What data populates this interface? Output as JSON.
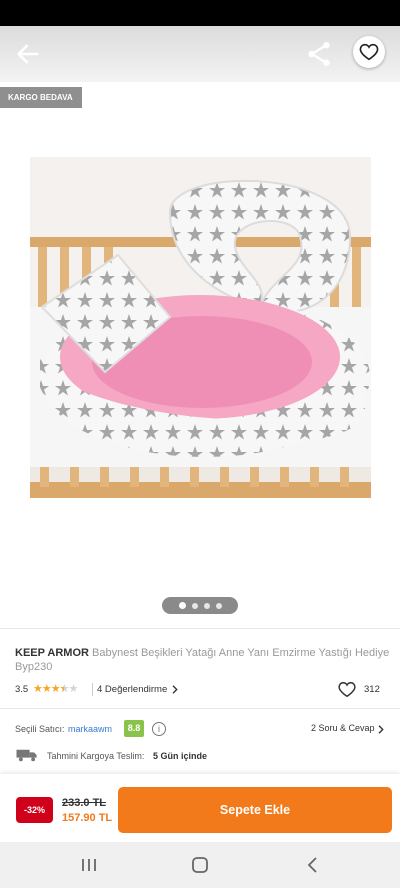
{
  "header": {
    "back_icon": "arrow-left-icon",
    "share_icon": "share-icon",
    "favorite_icon": "heart-outline-icon"
  },
  "badge": {
    "label": "KARGO BEDAVA"
  },
  "gallery": {
    "dot_count": 4,
    "active_index": 0
  },
  "product": {
    "brand": "KEEP ARMOR",
    "name": "Babynest Beşikleri Yatağı Anne Yanı Emzirme Yastığı Hediye Byp230",
    "rating": "3.5",
    "stars_filled": 3.5,
    "stars_total": 5,
    "reviews_label": "4 Değerlendirme",
    "favorite_count": "312"
  },
  "seller": {
    "label": "Seçili Satıcı:",
    "name": "markaawm",
    "score": "8.8",
    "qa_label": "2 Soru & Cevap"
  },
  "shipping": {
    "label": "Tahmini Kargoya Teslim:",
    "value": "5 Gün içinde"
  },
  "purchase": {
    "discount": "-32%",
    "old_price": "233.0 TL",
    "new_price": "157.90 TL",
    "add_to_cart": "Sepete Ekle"
  },
  "colors": {
    "accent": "#f27a1a",
    "discount": "#d0021b",
    "seller_score": "#8bc34a",
    "seller_link": "#3a7bd5"
  }
}
